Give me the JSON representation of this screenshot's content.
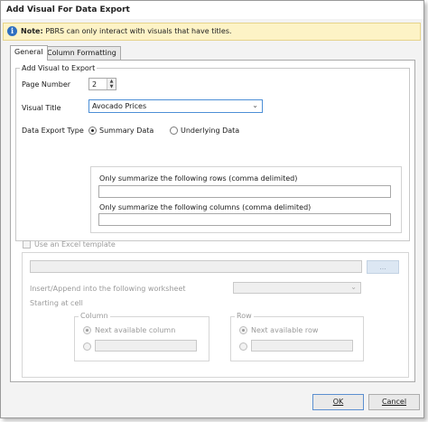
{
  "window": {
    "title": "Add Visual For Data Export"
  },
  "note": {
    "label": "Note:",
    "text": "PBRS can only interact with visuals that have titles."
  },
  "tabs": [
    {
      "label": "General",
      "active": true
    },
    {
      "label": "Column Formatting",
      "active": false
    }
  ],
  "general": {
    "section_label": "Add Visual to Export",
    "page_number_label": "Page Number",
    "page_number_value": "2",
    "visual_title_label": "Visual Title",
    "visual_title_value": "Avocado Prices",
    "data_export_type_label": "Data Export Type",
    "export_options": [
      {
        "label": "Summary Data",
        "selected": true
      },
      {
        "label": "Underlying Data",
        "selected": false
      }
    ],
    "summarize_rows_label": "Only summarize the following rows (comma delimited)",
    "summarize_rows_value": "",
    "summarize_columns_label": "Only summarize the following columns (comma delimited)",
    "summarize_columns_value": "",
    "excel_template_label": "Use an Excel template",
    "excel_template_checked": false,
    "template_path_value": "",
    "browse_label": "...",
    "worksheet_label": "Insert/Append into the following worksheet",
    "worksheet_value": "",
    "starting_cell_label": "Starting at cell",
    "column_group": {
      "legend": "Column",
      "next_label": "Next available column"
    },
    "row_group": {
      "legend": "Row",
      "next_label": "Next available row"
    }
  },
  "footer": {
    "ok_label": "OK",
    "cancel_label": "Cancel"
  },
  "colors": {
    "note_background": "#fdf3c6",
    "info_icon": "#2f6fc0",
    "ok_border": "#5b8fd0"
  }
}
